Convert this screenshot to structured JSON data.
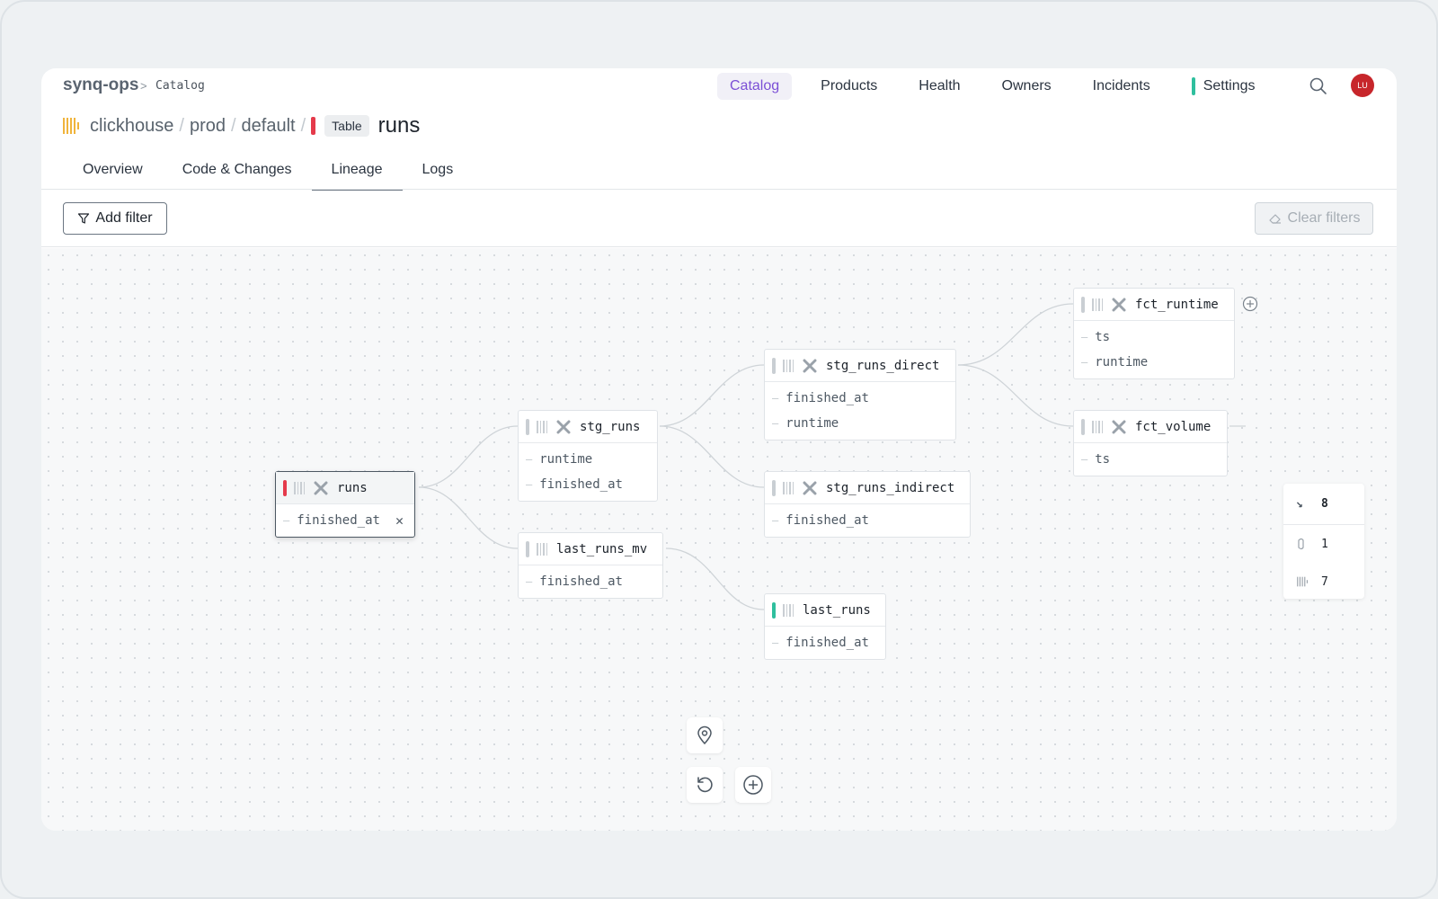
{
  "header": {
    "brand": "synq-ops",
    "breadcrumb_sep": ">",
    "breadcrumb_current": "Catalog",
    "nav": [
      {
        "label": "Catalog",
        "active": true
      },
      {
        "label": "Products",
        "active": false
      },
      {
        "label": "Health",
        "active": false
      },
      {
        "label": "Owners",
        "active": false
      },
      {
        "label": "Incidents",
        "active": false
      },
      {
        "label": "Settings",
        "active": false
      }
    ],
    "avatar_initials": "LU",
    "search_icon": "search-icon"
  },
  "path": {
    "segments": [
      "clickhouse",
      "prod",
      "default"
    ],
    "separator": "/",
    "type_badge": "Table",
    "table_name": "runs"
  },
  "tabs": [
    "Overview",
    "Code & Changes",
    "Lineage",
    "Logs"
  ],
  "active_tab": "Lineage",
  "filters": {
    "add_filter_label": "Add filter",
    "clear_filters_label": "Clear filters"
  },
  "lineage": {
    "nodes": [
      {
        "name": "runs",
        "status": "red",
        "selected": true,
        "columns": [
          "finished_at"
        ]
      },
      {
        "name": "stg_runs",
        "status": "gray",
        "selected": false,
        "columns": [
          "runtime",
          "finished_at"
        ]
      },
      {
        "name": "last_runs_mv",
        "status": "gray",
        "selected": false,
        "columns": [
          "finished_at"
        ]
      },
      {
        "name": "stg_runs_direct",
        "status": "gray",
        "selected": false,
        "columns": [
          "finished_at",
          "runtime"
        ]
      },
      {
        "name": "stg_runs_indirect",
        "status": "gray",
        "selected": false,
        "columns": [
          "finished_at"
        ]
      },
      {
        "name": "last_runs",
        "status": "green",
        "selected": false,
        "columns": [
          "finished_at"
        ]
      },
      {
        "name": "fct_runtime",
        "status": "gray",
        "selected": false,
        "columns": [
          "ts",
          "runtime"
        ]
      },
      {
        "name": "fct_volume",
        "status": "gray",
        "selected": false,
        "columns": [
          "ts"
        ]
      }
    ]
  },
  "stats": {
    "total": "8",
    "dbt_count": "1",
    "clickhouse_count": "7"
  },
  "colors": {
    "accent": "#7b4fd6",
    "status_red": "#e53a4b",
    "status_green": "#2fbf9e",
    "clickhouse_yellow": "#f0b43c",
    "avatar_bg": "#c7262b"
  }
}
